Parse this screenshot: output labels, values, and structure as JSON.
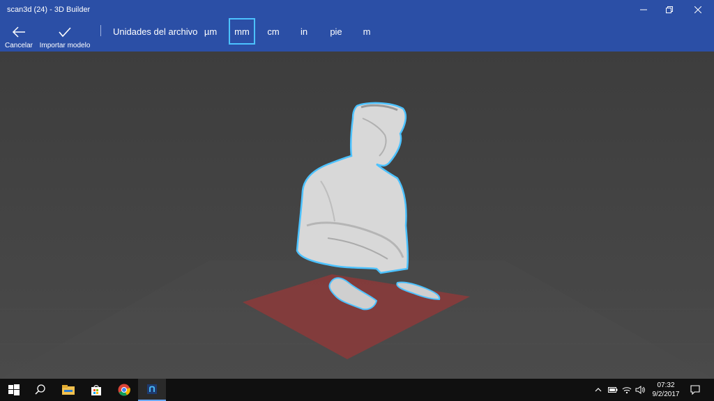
{
  "window": {
    "title": "scan3d (24) - 3D Builder"
  },
  "toolbar": {
    "cancel_label": "Cancelar",
    "import_label": "Importar modelo",
    "units_label": "Unidades del archivo",
    "units": [
      {
        "label": "µm",
        "selected": false
      },
      {
        "label": "mm",
        "selected": true
      },
      {
        "label": "cm",
        "selected": false
      },
      {
        "label": "in",
        "selected": false
      },
      {
        "label": "pie",
        "selected": false
      },
      {
        "label": "m",
        "selected": false
      }
    ]
  },
  "taskbar": {
    "apps": [
      "start-icon",
      "search-icon",
      "file-explorer-icon",
      "store-icon",
      "chrome-icon",
      "3d-builder-icon"
    ],
    "clock_time": "07:32",
    "clock_date": "9/2/2017"
  },
  "colors": {
    "accent": "#2b4fa6",
    "selection": "#4cc2ff",
    "build_plate": "#8c3a3a",
    "model": "#d8d8d8"
  }
}
